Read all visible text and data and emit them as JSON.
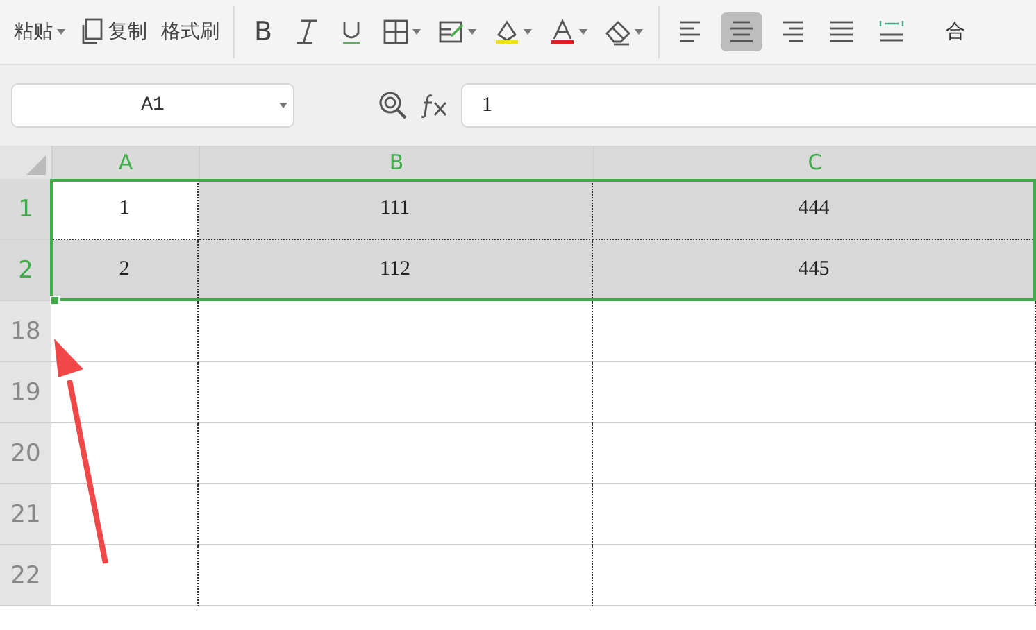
{
  "toolbar": {
    "clipboard": [
      {
        "kind": "paste",
        "label": "粘贴"
      },
      {
        "kind": "copy",
        "label": "复制"
      },
      {
        "kind": "painter",
        "label": "格式刷"
      }
    ],
    "font_buttons": [
      {
        "kind": "bold",
        "label": "B"
      },
      {
        "kind": "italic"
      },
      {
        "kind": "underline"
      },
      {
        "kind": "border"
      },
      {
        "kind": "cellstyle"
      },
      {
        "kind": "fill"
      },
      {
        "kind": "fontcolor"
      },
      {
        "kind": "eraser"
      }
    ],
    "align_buttons": [
      {
        "kind": "left",
        "selected": false
      },
      {
        "kind": "center",
        "selected": true
      },
      {
        "kind": "right",
        "selected": false
      },
      {
        "kind": "justify",
        "selected": false
      },
      {
        "kind": "distributed",
        "selected": false
      }
    ],
    "merge_label": "合"
  },
  "formula_bar": {
    "name_box": "A1",
    "formula": "1"
  },
  "columns": [
    {
      "label": "A",
      "selected": true
    },
    {
      "label": "B",
      "selected": true
    },
    {
      "label": "C",
      "selected": true
    }
  ],
  "rows": [
    {
      "label": "1",
      "selected": true,
      "cells": [
        {
          "value": "1",
          "active": true
        },
        {
          "value": "111",
          "active": false
        },
        {
          "value": "444",
          "active": false
        }
      ]
    },
    {
      "label": "2",
      "selected": true,
      "cells": [
        {
          "value": "2",
          "active": false
        },
        {
          "value": "112",
          "active": false
        },
        {
          "value": "445",
          "active": false
        }
      ]
    },
    {
      "label": "18",
      "selected": false,
      "cells": [
        {
          "active": false
        },
        {
          "active": false
        },
        {
          "active": false
        }
      ]
    },
    {
      "label": "19",
      "selected": false,
      "cells": [
        {
          "active": false
        },
        {
          "active": false
        },
        {
          "active": false
        }
      ]
    },
    {
      "label": "20",
      "selected": false,
      "cells": [
        {
          "active": false
        },
        {
          "active": false
        },
        {
          "active": false
        }
      ]
    },
    {
      "label": "21",
      "selected": false,
      "cells": [
        {
          "active": false
        },
        {
          "active": false
        },
        {
          "active": false
        }
      ]
    },
    {
      "label": "22",
      "selected": false,
      "cells": [
        {
          "active": false
        },
        {
          "active": false
        },
        {
          "active": false
        }
      ]
    }
  ]
}
